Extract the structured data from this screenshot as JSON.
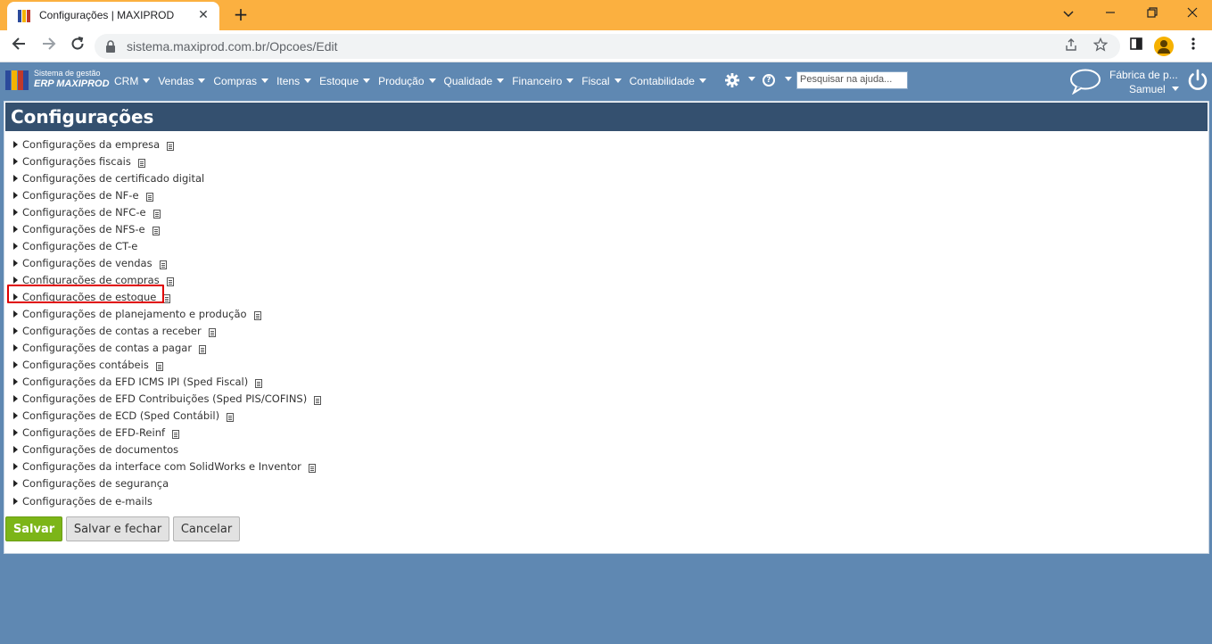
{
  "browser": {
    "tab_title": "Configurações | MAXIPROD",
    "tab_close": "✕",
    "new_tab": "+",
    "url": "sistema.maxiprod.com.br/Opcoes/Edit",
    "window_controls": {
      "minimize": "⌵",
      "min": "—",
      "restore": "❐",
      "close": "✕"
    }
  },
  "app": {
    "logo_line1": "Sistema de gestão",
    "logo_line2": "ERP MAXIPROD",
    "menu": [
      "CRM",
      "Vendas",
      "Compras",
      "Itens",
      "Estoque",
      "Produção",
      "Qualidade",
      "Financeiro",
      "Fiscal",
      "Contabilidade"
    ],
    "help_symbol": "?",
    "search_placeholder": "Pesquisar na ajuda...",
    "company": "Fábrica de p...",
    "user": "Samuel"
  },
  "page": {
    "title": "Configurações",
    "items": [
      {
        "label": "Configurações da empresa",
        "doc": true
      },
      {
        "label": "Configurações fiscais",
        "doc": true
      },
      {
        "label": "Configurações de certificado digital",
        "doc": false
      },
      {
        "label": "Configurações de NF-e",
        "doc": true
      },
      {
        "label": "Configurações de NFC-e",
        "doc": true
      },
      {
        "label": "Configurações de NFS-e",
        "doc": true
      },
      {
        "label": "Configurações de CT-e",
        "doc": false
      },
      {
        "label": "Configurações de vendas",
        "doc": true
      },
      {
        "label": "Configurações de compras",
        "doc": true
      },
      {
        "label": "Configurações de estoque",
        "doc": true,
        "highlighted": true
      },
      {
        "label": "Configurações de planejamento e produção",
        "doc": true
      },
      {
        "label": "Configurações de contas a receber",
        "doc": true
      },
      {
        "label": "Configurações de contas a pagar",
        "doc": true
      },
      {
        "label": "Configurações contábeis",
        "doc": true
      },
      {
        "label": "Configurações da EFD ICMS IPI (Sped Fiscal)",
        "doc": true
      },
      {
        "label": "Configurações de EFD Contribuições (Sped PIS/COFINS)",
        "doc": true
      },
      {
        "label": "Configurações de ECD (Sped Contábil)",
        "doc": true
      },
      {
        "label": "Configurações de EFD-Reinf",
        "doc": true
      },
      {
        "label": "Configurações de documentos",
        "doc": false
      },
      {
        "label": "Configurações da interface com SolidWorks e Inventor",
        "doc": true
      },
      {
        "label": "Configurações de segurança",
        "doc": false
      },
      {
        "label": "Configurações de e-mails",
        "doc": false
      }
    ],
    "buttons": {
      "save": "Salvar",
      "save_close": "Salvar e fechar",
      "cancel": "Cancelar"
    }
  },
  "colors": {
    "tabbar": "#fbb040",
    "app_bg": "#5f88b2",
    "header": "#34506f",
    "save_btn": "#7cb518",
    "highlight": "#e00000"
  }
}
